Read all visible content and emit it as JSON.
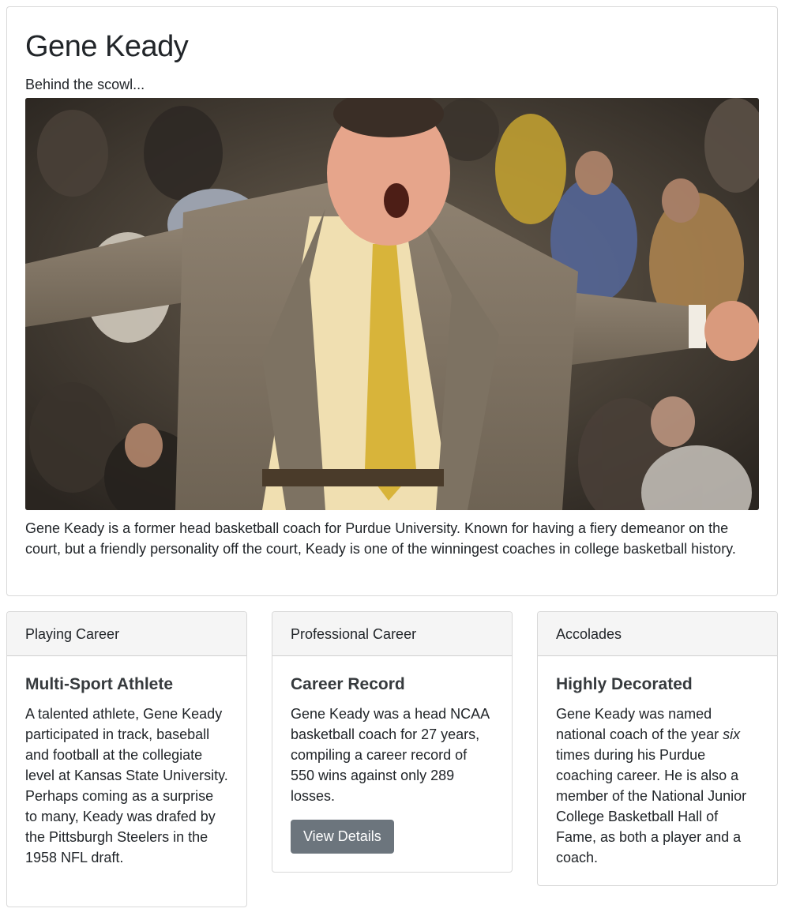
{
  "hero": {
    "title": "Gene Keady",
    "subtitle": "Behind the scowl...",
    "description": "Gene Keady is a former head basketball coach for Purdue University. Known for having a fiery demeanor on the court, but a friendly personality off the court, Keady is one of the winningest coaches in college basketball history."
  },
  "cards": [
    {
      "header": "Playing Career",
      "title": "Multi-Sport Athlete",
      "text": "A talented athlete, Gene Keady participated in track, baseball and football at the collegiate level at Kansas State University. Perhaps coming as a surprise to many, Keady was drafed by the Pittsburgh Steelers in the 1958 NFL draft."
    },
    {
      "header": "Professional Career",
      "title": "Career Record",
      "text": "Gene Keady was a head NCAA basketball coach for 27 years, compiling a career record of 550 wins against only 289 losses.",
      "button_label": "View Details"
    },
    {
      "header": "Accolades",
      "title": "Highly Decorated",
      "text_before": "Gene Keady was named national coach of the year ",
      "text_em": "six",
      "text_after": " times during his Purdue coaching career. He is also a member of the National Junior College Basketball Hall of Fame, as both a player and a coach."
    }
  ],
  "colors": {
    "button_bg": "#6c757d",
    "header_bg": "#f5f5f5",
    "text": "#212529"
  }
}
